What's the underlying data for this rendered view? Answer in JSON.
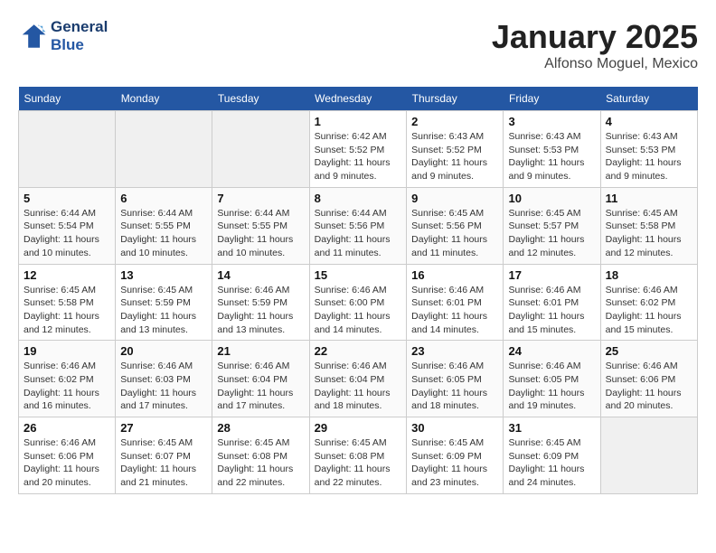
{
  "header": {
    "logo_line1": "General",
    "logo_line2": "Blue",
    "month": "January 2025",
    "location": "Alfonso Moguel, Mexico"
  },
  "weekdays": [
    "Sunday",
    "Monday",
    "Tuesday",
    "Wednesday",
    "Thursday",
    "Friday",
    "Saturday"
  ],
  "weeks": [
    [
      {
        "day": "",
        "empty": true
      },
      {
        "day": "",
        "empty": true
      },
      {
        "day": "",
        "empty": true
      },
      {
        "day": "1",
        "sunrise": "6:42 AM",
        "sunset": "5:52 PM",
        "daylight": "11 hours and 9 minutes."
      },
      {
        "day": "2",
        "sunrise": "6:43 AM",
        "sunset": "5:52 PM",
        "daylight": "11 hours and 9 minutes."
      },
      {
        "day": "3",
        "sunrise": "6:43 AM",
        "sunset": "5:53 PM",
        "daylight": "11 hours and 9 minutes."
      },
      {
        "day": "4",
        "sunrise": "6:43 AM",
        "sunset": "5:53 PM",
        "daylight": "11 hours and 9 minutes."
      }
    ],
    [
      {
        "day": "5",
        "sunrise": "6:44 AM",
        "sunset": "5:54 PM",
        "daylight": "11 hours and 10 minutes."
      },
      {
        "day": "6",
        "sunrise": "6:44 AM",
        "sunset": "5:55 PM",
        "daylight": "11 hours and 10 minutes."
      },
      {
        "day": "7",
        "sunrise": "6:44 AM",
        "sunset": "5:55 PM",
        "daylight": "11 hours and 10 minutes."
      },
      {
        "day": "8",
        "sunrise": "6:44 AM",
        "sunset": "5:56 PM",
        "daylight": "11 hours and 11 minutes."
      },
      {
        "day": "9",
        "sunrise": "6:45 AM",
        "sunset": "5:56 PM",
        "daylight": "11 hours and 11 minutes."
      },
      {
        "day": "10",
        "sunrise": "6:45 AM",
        "sunset": "5:57 PM",
        "daylight": "11 hours and 12 minutes."
      },
      {
        "day": "11",
        "sunrise": "6:45 AM",
        "sunset": "5:58 PM",
        "daylight": "11 hours and 12 minutes."
      }
    ],
    [
      {
        "day": "12",
        "sunrise": "6:45 AM",
        "sunset": "5:58 PM",
        "daylight": "11 hours and 12 minutes."
      },
      {
        "day": "13",
        "sunrise": "6:45 AM",
        "sunset": "5:59 PM",
        "daylight": "11 hours and 13 minutes."
      },
      {
        "day": "14",
        "sunrise": "6:46 AM",
        "sunset": "5:59 PM",
        "daylight": "11 hours and 13 minutes."
      },
      {
        "day": "15",
        "sunrise": "6:46 AM",
        "sunset": "6:00 PM",
        "daylight": "11 hours and 14 minutes."
      },
      {
        "day": "16",
        "sunrise": "6:46 AM",
        "sunset": "6:01 PM",
        "daylight": "11 hours and 14 minutes."
      },
      {
        "day": "17",
        "sunrise": "6:46 AM",
        "sunset": "6:01 PM",
        "daylight": "11 hours and 15 minutes."
      },
      {
        "day": "18",
        "sunrise": "6:46 AM",
        "sunset": "6:02 PM",
        "daylight": "11 hours and 15 minutes."
      }
    ],
    [
      {
        "day": "19",
        "sunrise": "6:46 AM",
        "sunset": "6:02 PM",
        "daylight": "11 hours and 16 minutes."
      },
      {
        "day": "20",
        "sunrise": "6:46 AM",
        "sunset": "6:03 PM",
        "daylight": "11 hours and 17 minutes."
      },
      {
        "day": "21",
        "sunrise": "6:46 AM",
        "sunset": "6:04 PM",
        "daylight": "11 hours and 17 minutes."
      },
      {
        "day": "22",
        "sunrise": "6:46 AM",
        "sunset": "6:04 PM",
        "daylight": "11 hours and 18 minutes."
      },
      {
        "day": "23",
        "sunrise": "6:46 AM",
        "sunset": "6:05 PM",
        "daylight": "11 hours and 18 minutes."
      },
      {
        "day": "24",
        "sunrise": "6:46 AM",
        "sunset": "6:05 PM",
        "daylight": "11 hours and 19 minutes."
      },
      {
        "day": "25",
        "sunrise": "6:46 AM",
        "sunset": "6:06 PM",
        "daylight": "11 hours and 20 minutes."
      }
    ],
    [
      {
        "day": "26",
        "sunrise": "6:46 AM",
        "sunset": "6:06 PM",
        "daylight": "11 hours and 20 minutes."
      },
      {
        "day": "27",
        "sunrise": "6:45 AM",
        "sunset": "6:07 PM",
        "daylight": "11 hours and 21 minutes."
      },
      {
        "day": "28",
        "sunrise": "6:45 AM",
        "sunset": "6:08 PM",
        "daylight": "11 hours and 22 minutes."
      },
      {
        "day": "29",
        "sunrise": "6:45 AM",
        "sunset": "6:08 PM",
        "daylight": "11 hours and 22 minutes."
      },
      {
        "day": "30",
        "sunrise": "6:45 AM",
        "sunset": "6:09 PM",
        "daylight": "11 hours and 23 minutes."
      },
      {
        "day": "31",
        "sunrise": "6:45 AM",
        "sunset": "6:09 PM",
        "daylight": "11 hours and 24 minutes."
      },
      {
        "day": "",
        "empty": true
      }
    ]
  ]
}
